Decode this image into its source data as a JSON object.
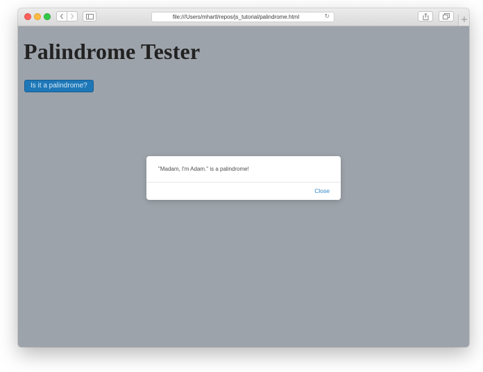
{
  "browser": {
    "url": "file:///Users/mhartl/repos/js_tutorial/palindrome.html",
    "icons": {
      "back": "chevron-left-icon",
      "forward": "chevron-right-icon",
      "sidebar": "sidebar-icon",
      "reload": "reload-icon",
      "share": "share-icon",
      "tabs": "tabs-overview-icon",
      "new_tab": "plus-icon"
    },
    "reload_glyph": "↻",
    "new_tab_glyph": "+"
  },
  "page": {
    "title": "Palindrome Tester",
    "button_label": "Is it a palindrome?",
    "background_color": "#9da3aa",
    "button_color": "#1e78b8"
  },
  "dialog": {
    "message": "\"Madam, I'm Adam.\" is a palindrome!",
    "close_label": "Close"
  }
}
